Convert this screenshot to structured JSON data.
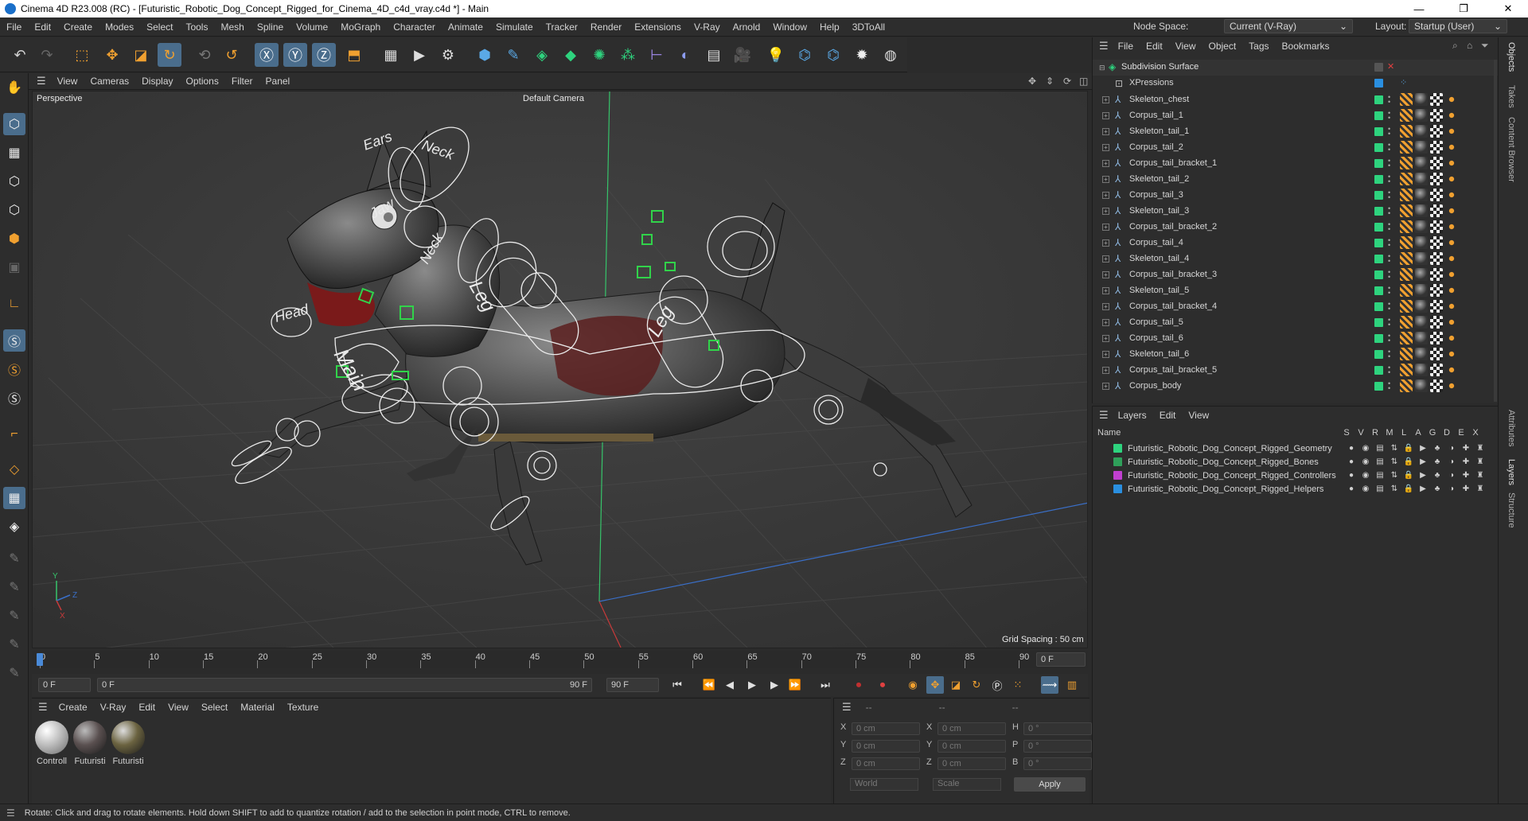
{
  "app": {
    "title": "Cinema 4D R23.008 (RC) - [Futuristic_Robotic_Dog_Concept_Rigged_for_Cinema_4D_c4d_vray.c4d *] - Main",
    "minimize": "—",
    "maximize": "❐",
    "close": "✕"
  },
  "menubar": {
    "items": [
      "File",
      "Edit",
      "Create",
      "Modes",
      "Select",
      "Tools",
      "Mesh",
      "Spline",
      "Volume",
      "MoGraph",
      "Character",
      "Animate",
      "Simulate",
      "Tracker",
      "Render",
      "Extensions",
      "V-Ray",
      "Arnold",
      "Window",
      "Help",
      "3DToAll"
    ],
    "node_space_label": "Node Space:",
    "node_space_value": "Current (V-Ray)",
    "layout_label": "Layout:",
    "layout_value": "Startup (User)"
  },
  "viewport": {
    "menu": [
      "View",
      "Cameras",
      "Display",
      "Options",
      "Filter",
      "Panel"
    ],
    "view_name": "Perspective",
    "camera": "Default Camera",
    "grid_spacing": "Grid Spacing : 50 cm",
    "labels": {
      "ears": "Ears",
      "neck_top": "Neck",
      "jaw": "Jaw",
      "neck": "Neck",
      "head": "Head",
      "main": "Main",
      "leg_front": "Leg",
      "leg_back": "Leg"
    },
    "axis": {
      "y": "Y",
      "z": "Z",
      "x": "X"
    }
  },
  "timeline": {
    "ticks": [
      "0",
      "5",
      "10",
      "15",
      "20",
      "25",
      "30",
      "35",
      "40",
      "45",
      "50",
      "55",
      "60",
      "65",
      "70",
      "75",
      "80",
      "85",
      "90"
    ],
    "current_frame_right": "0 F",
    "start_field": "0 F",
    "range_start": "0 F",
    "range_end": "90 F",
    "end_field": "90 F",
    "last_frame": 90,
    "current_frame": 0
  },
  "material_manager": {
    "menu": [
      "Create",
      "V-Ray",
      "Edit",
      "View",
      "Select",
      "Material",
      "Texture"
    ],
    "materials": [
      {
        "name": "Controll",
        "color": "#cfcfcf"
      },
      {
        "name": "Futuristi",
        "color": "#5a5050"
      },
      {
        "name": "Futuristi",
        "color": "#6b6340"
      }
    ]
  },
  "attributes": {
    "header": [
      "--",
      "--",
      "--"
    ],
    "rows": [
      {
        "l1": "X",
        "v1": "0 cm",
        "l2": "X",
        "v2": "0 cm",
        "l3": "H",
        "v3": "0 °"
      },
      {
        "l1": "Y",
        "v1": "0 cm",
        "l2": "Y",
        "v2": "0 cm",
        "l3": "P",
        "v3": "0 °"
      },
      {
        "l1": "Z",
        "v1": "0 cm",
        "l2": "Z",
        "v2": "0 cm",
        "l3": "B",
        "v3": "0 °"
      }
    ],
    "coord_system": "World",
    "mode": "Scale",
    "apply": "Apply"
  },
  "object_manager": {
    "menu": [
      "File",
      "Edit",
      "View",
      "Object",
      "Tags",
      "Bookmarks"
    ],
    "root": "Subdivision Surface",
    "xpressions": "XPressions",
    "objects": [
      "Skeleton_chest",
      "Corpus_tail_1",
      "Skeleton_tail_1",
      "Corpus_tail_2",
      "Corpus_tail_bracket_1",
      "Skeleton_tail_2",
      "Corpus_tail_3",
      "Skeleton_tail_3",
      "Corpus_tail_bracket_2",
      "Corpus_tail_4",
      "Skeleton_tail_4",
      "Corpus_tail_bracket_3",
      "Skeleton_tail_5",
      "Corpus_tail_bracket_4",
      "Corpus_tail_5",
      "Corpus_tail_6",
      "Skeleton_tail_6",
      "Corpus_tail_bracket_5",
      "Corpus_body"
    ]
  },
  "layer_manager": {
    "menu": [
      "Layers",
      "Edit",
      "View"
    ],
    "name_header": "Name",
    "col_headers": [
      "S",
      "V",
      "R",
      "M",
      "L",
      "A",
      "G",
      "D",
      "E",
      "X"
    ],
    "layers": [
      {
        "name": "Futuristic_Robotic_Dog_Concept_Rigged_Geometry",
        "color": "#2ed37e"
      },
      {
        "name": "Futuristic_Robotic_Dog_Concept_Rigged_Bones",
        "color": "#2fa05a"
      },
      {
        "name": "Futuristic_Robotic_Dog_Concept_Rigged_Controllers",
        "color": "#c03fd0"
      },
      {
        "name": "Futuristic_Robotic_Dog_Concept_Rigged_Helpers",
        "color": "#2a8fe0"
      }
    ]
  },
  "side_tabs": [
    "Objects",
    "Takes",
    "Content Browser",
    "Attributes",
    "Layers",
    "Structure"
  ],
  "status": "Rotate: Click and drag to rotate elements. Hold down SHIFT to add to quantize rotation / add to the selection in point mode, CTRL to remove.",
  "colors": {
    "accent": "#4a6d8c",
    "green": "#2ed37e",
    "bg": "#2d2d2d"
  }
}
